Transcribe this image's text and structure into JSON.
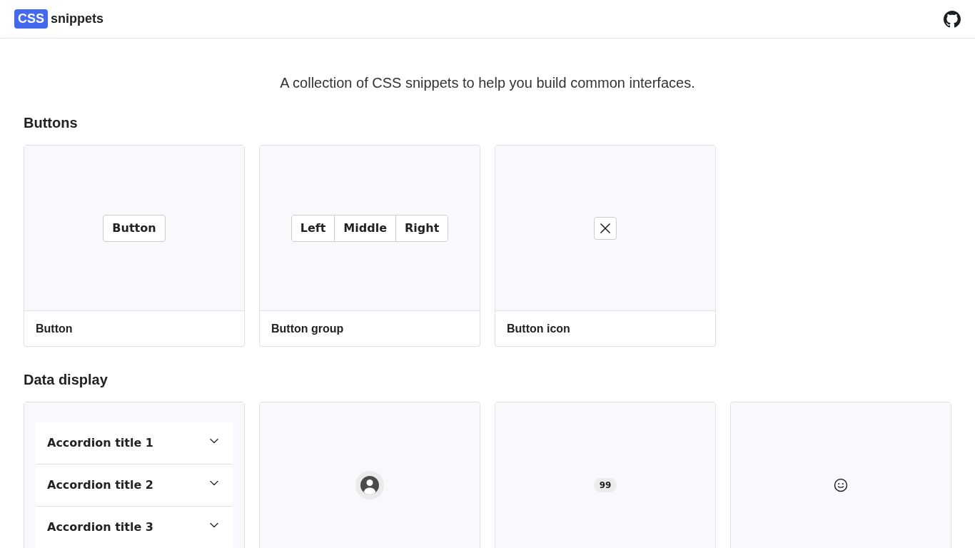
{
  "header": {
    "logo": {
      "badge": "CSS",
      "text": "snippets"
    }
  },
  "tagline": "A collection of CSS snippets to help you build common interfaces.",
  "sections": [
    {
      "title": "Buttons",
      "cards": [
        {
          "kind": "button",
          "label": "Button",
          "demo": {
            "text": "Button"
          }
        },
        {
          "kind": "button_group",
          "label": "Button group",
          "demo": {
            "buttons": [
              "Left",
              "Middle",
              "Right"
            ]
          }
        },
        {
          "kind": "button_icon",
          "label": "Button icon"
        }
      ]
    },
    {
      "title": "Data display",
      "cards": [
        {
          "kind": "accordion",
          "demo": {
            "items": [
              {
                "title": "Accordion title 1",
                "expanded": false
              },
              {
                "title": "Accordion title 2",
                "expanded": false
              },
              {
                "title": "Accordion title 3",
                "expanded": false
              }
            ]
          }
        },
        {
          "kind": "avatar"
        },
        {
          "kind": "badge",
          "demo": {
            "text": "99"
          }
        },
        {
          "kind": "icon"
        }
      ]
    }
  ]
}
